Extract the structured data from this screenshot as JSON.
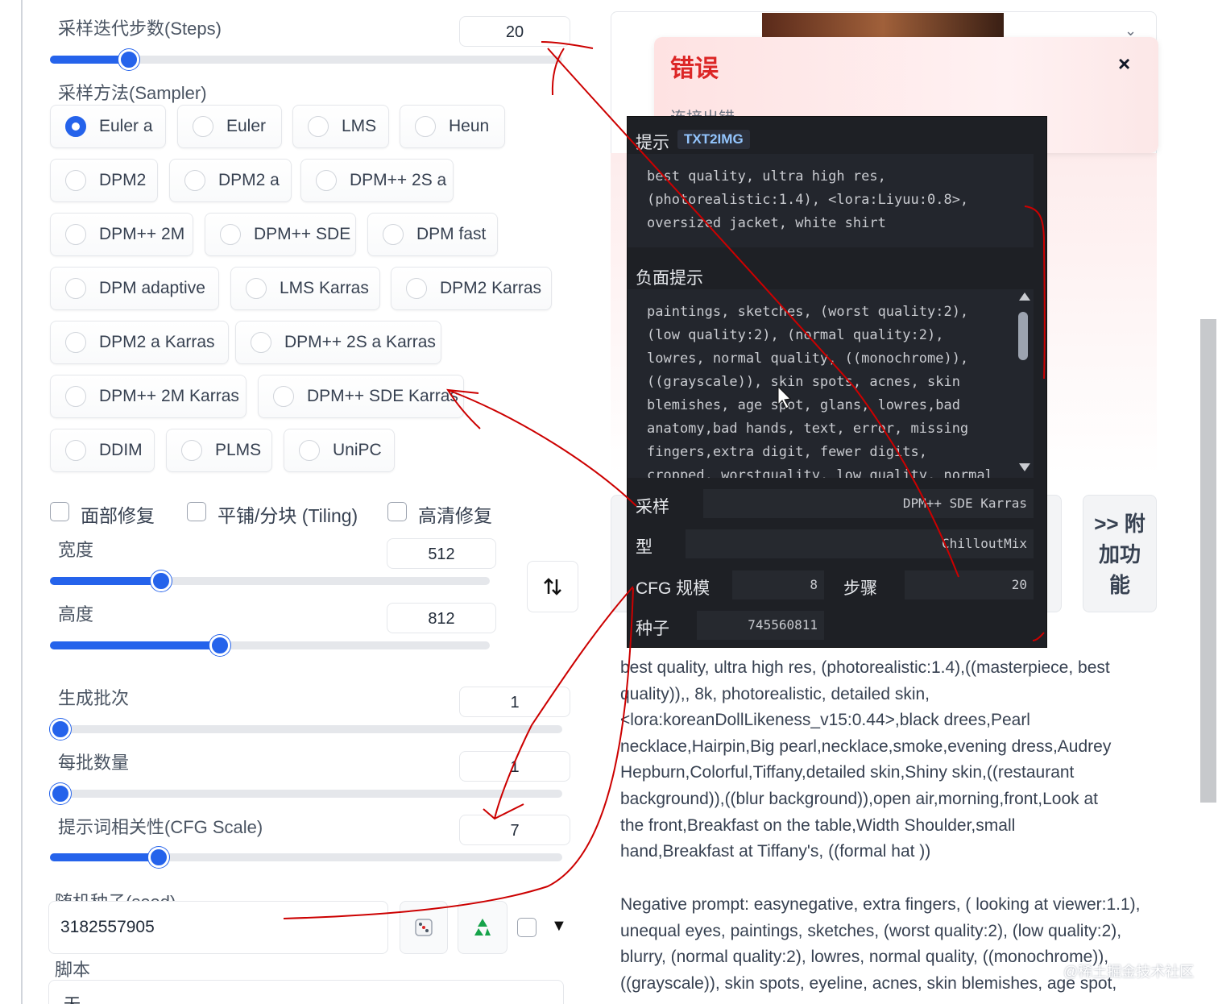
{
  "steps": {
    "label": "采样迭代步数(Steps)",
    "value": "20",
    "fraction": 0.14
  },
  "sampler": {
    "label": "采样方法(Sampler)",
    "selected": "Euler a",
    "options": [
      "Euler a",
      "Euler",
      "LMS",
      "Heun",
      "DPM2",
      "DPM2 a",
      "DPM++ 2S a",
      "DPM++ 2M",
      "DPM++ SDE",
      "DPM fast",
      "DPM adaptive",
      "LMS Karras",
      "DPM2 Karras",
      "DPM2 a Karras",
      "DPM++ 2S a Karras",
      "DPM++ 2M Karras",
      "DPM++ SDE Karras",
      "DDIM",
      "PLMS",
      "UniPC"
    ]
  },
  "checkboxes": {
    "face_restore": "面部修复",
    "tiling": "平铺/分块 (Tiling)",
    "hires_fix": "高清修复"
  },
  "width": {
    "label": "宽度",
    "value": "512",
    "fraction": 0.24
  },
  "height": {
    "label": "高度",
    "value": "812",
    "fraction": 0.38
  },
  "batch_count": {
    "label": "生成批次",
    "value": "1",
    "fraction": 0.0
  },
  "batch_size": {
    "label": "每批数量",
    "value": "1",
    "fraction": 0.0
  },
  "cfg_scale": {
    "label": "提示词相关性(CFG Scale)",
    "value": "7",
    "fraction": 0.2
  },
  "seed": {
    "label": "随机种子(seed)",
    "value": "3182557905"
  },
  "script": {
    "label": "脚本",
    "value": "无"
  },
  "error": {
    "title": "错误",
    "close": "×",
    "partial": "连接出错"
  },
  "popup": {
    "prompt_label": "提示",
    "badge": "TXT2IMG",
    "prompt_lines": [
      "best quality, ultra high res,",
      "(photorealistic:1.4), <lora:Liyuu:0.8>,",
      "oversized jacket, white shirt"
    ],
    "negative_label": "负面提示",
    "negative_lines": [
      "paintings, sketches, (worst quality:2),",
      "(low quality:2), (normal quality:2),",
      "lowres, normal quality, ((monochrome)),",
      "((grayscale)), skin spots, acnes, skin",
      "blemishes, age spot, glans, lowres,bad",
      "anatomy,bad hands, text, error, missing",
      "fingers,extra digit, fewer digits,",
      "cropped, worstquality, low quality, normal"
    ],
    "sampler_label": "采样",
    "sampler_value": "DPM++ SDE Karras",
    "model_label": "型",
    "model_value": "ChilloutMix",
    "cfg_label": "CFG 规模",
    "cfg_value": "8",
    "steps_label": "步骤",
    "steps_value": "20",
    "seed_label": "种子",
    "seed_value": "745560811"
  },
  "addon_button": ">> 附加功能",
  "addon_lines": [
    ">> 附",
    "加功",
    "能"
  ],
  "prompt_lines": [
    "best quality, ultra high res, (photorealistic:1.4),((masterpiece, best",
    "quality)),, 8k, photorealistic, detailed skin,",
    "<lora:koreanDollLikeness_v15:0.44>,black drees,Pearl",
    "necklace,Hairpin,Big pearl,necklace,smoke,evening dress,Audrey",
    "Hepburn,Colorful,Tiffany,detailed skin,Shiny skin,((restaurant",
    "background)),((blur background)),open air,morning,front,Look at",
    "the front,Breakfast on the table,Width Shoulder,small",
    "hand,Breakfast at Tiffany's, ((formal hat ))"
  ],
  "negative_lines": [
    "Negative prompt: easynegative, extra fingers, ( looking at viewer:1.1),",
    "unequal eyes, paintings, sketches, (worst quality:2), (low quality:2),",
    "blurry, (normal quality:2), lowres, normal quality, ((monochrome)),",
    "((grayscale)), skin spots, eyeline, acnes, skin blemishes, age spot,"
  ],
  "watermark": "@稀土掘金技术社区",
  "icons": {
    "swap": "swap-vertical-icon",
    "dice": "dice-icon",
    "recycle": "recycle-icon",
    "dropdown": "triangle-down-icon"
  },
  "colors": {
    "accent": "#2563eb",
    "error": "#dc2626",
    "popup_bg": "#1e2025",
    "annotation": "#cc0000"
  }
}
